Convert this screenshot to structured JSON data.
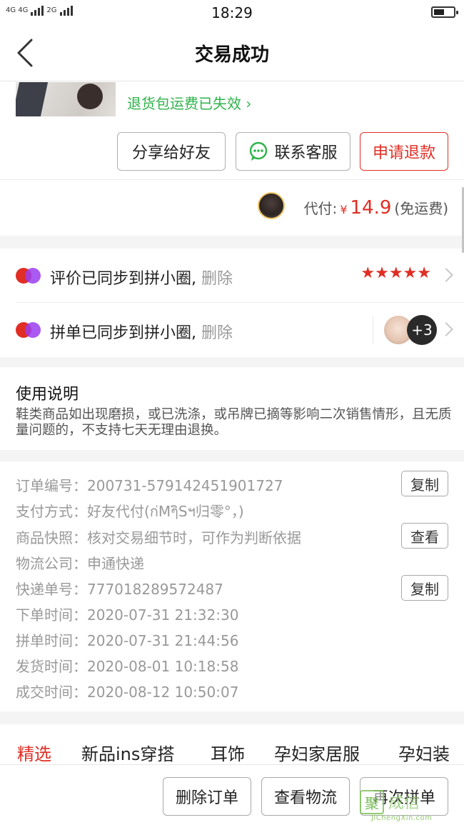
{
  "status_bar": {
    "time": "18:29",
    "net_1": "4G 4G",
    "net_2": "2G",
    "battery_level": 0.55
  },
  "nav": {
    "title": "交易成功"
  },
  "product": {
    "return_tip": "退货包运费已失效",
    "share_label": "分享给好友",
    "service_label": "联系客服",
    "refund_label": "申请退款"
  },
  "payment": {
    "label": "代付:",
    "currency": "¥",
    "amount": "14.9",
    "note": "(免运费)"
  },
  "sync": {
    "review_text": "评价已同步到拼小圈,",
    "review_delete": "删除",
    "review_stars": "★★★★★",
    "group_text": "拼单已同步到拼小圈,",
    "group_delete": "删除",
    "group_more": "+3"
  },
  "usage": {
    "title": "使用说明",
    "body": "鞋类商品如出现磨损，或已洗涤，或吊牌已摘等影响二次销售情形，且无质量问题的，不支持七天无理由退换。"
  },
  "details": {
    "rows": [
      {
        "label": "订单编号：",
        "value": "200731-579142451901727",
        "action": "复制"
      },
      {
        "label": "支付方式：",
        "value": "好友代付(ก่MๆิSฯ归零°，)"
      },
      {
        "label": "商品快照：",
        "value": "核对交易细节时，可作为判断依据",
        "action": "查看"
      },
      {
        "label": "物流公司：",
        "value": "申通快递"
      },
      {
        "label": "快递单号：",
        "value": "777018289572487",
        "action": "复制"
      },
      {
        "label": "下单时间：",
        "value": "2020-07-31 21:32:30"
      },
      {
        "label": "拼单时间：",
        "value": "2020-07-31 21:44:56"
      },
      {
        "label": "发货时间：",
        "value": "2020-08-01 10:18:58"
      },
      {
        "label": "成交时间：",
        "value": "2020-08-12 10:50:07"
      }
    ]
  },
  "tabs": [
    "精选",
    "新品ins穿搭",
    "耳饰",
    "孕妇家居服",
    "孕妇装"
  ],
  "bottom_bar": {
    "delete_label": "删除订单",
    "logistics_label": "查看物流",
    "rebuy_label": "再次拼单"
  },
  "watermark": {
    "char": "聚",
    "text": "成信",
    "url": "JiChengXin.com"
  },
  "colors": {
    "accent_red": "#e02e24",
    "green": "#2eb34a",
    "wechat_green": "#2eb34a"
  }
}
